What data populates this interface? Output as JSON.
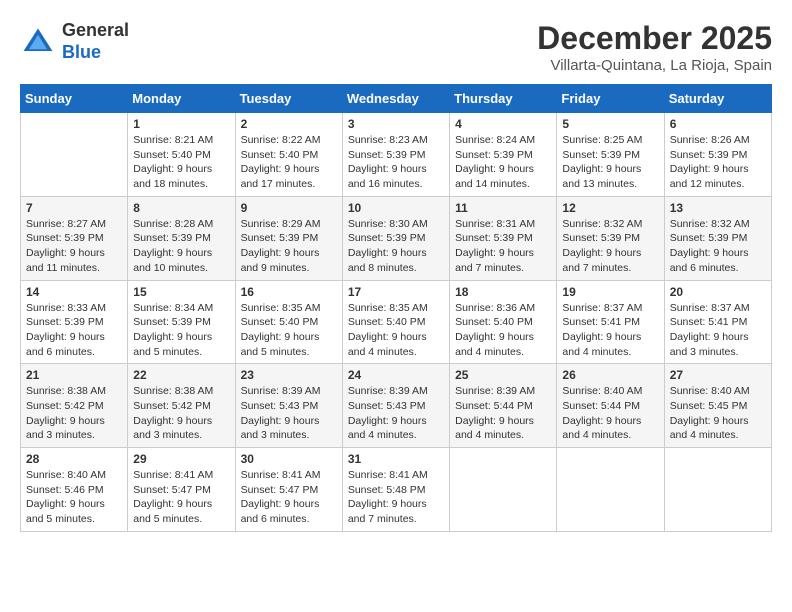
{
  "header": {
    "logo": {
      "general": "General",
      "blue": "Blue"
    },
    "title": "December 2025",
    "subtitle": "Villarta-Quintana, La Rioja, Spain"
  },
  "weekdays": [
    "Sunday",
    "Monday",
    "Tuesday",
    "Wednesday",
    "Thursday",
    "Friday",
    "Saturday"
  ],
  "weeks": [
    [
      {
        "day": "",
        "sunrise": "",
        "sunset": "",
        "daylight": ""
      },
      {
        "day": "1",
        "sunrise": "Sunrise: 8:21 AM",
        "sunset": "Sunset: 5:40 PM",
        "daylight": "Daylight: 9 hours and 18 minutes."
      },
      {
        "day": "2",
        "sunrise": "Sunrise: 8:22 AM",
        "sunset": "Sunset: 5:40 PM",
        "daylight": "Daylight: 9 hours and 17 minutes."
      },
      {
        "day": "3",
        "sunrise": "Sunrise: 8:23 AM",
        "sunset": "Sunset: 5:39 PM",
        "daylight": "Daylight: 9 hours and 16 minutes."
      },
      {
        "day": "4",
        "sunrise": "Sunrise: 8:24 AM",
        "sunset": "Sunset: 5:39 PM",
        "daylight": "Daylight: 9 hours and 14 minutes."
      },
      {
        "day": "5",
        "sunrise": "Sunrise: 8:25 AM",
        "sunset": "Sunset: 5:39 PM",
        "daylight": "Daylight: 9 hours and 13 minutes."
      },
      {
        "day": "6",
        "sunrise": "Sunrise: 8:26 AM",
        "sunset": "Sunset: 5:39 PM",
        "daylight": "Daylight: 9 hours and 12 minutes."
      }
    ],
    [
      {
        "day": "7",
        "sunrise": "Sunrise: 8:27 AM",
        "sunset": "Sunset: 5:39 PM",
        "daylight": "Daylight: 9 hours and 11 minutes."
      },
      {
        "day": "8",
        "sunrise": "Sunrise: 8:28 AM",
        "sunset": "Sunset: 5:39 PM",
        "daylight": "Daylight: 9 hours and 10 minutes."
      },
      {
        "day": "9",
        "sunrise": "Sunrise: 8:29 AM",
        "sunset": "Sunset: 5:39 PM",
        "daylight": "Daylight: 9 hours and 9 minutes."
      },
      {
        "day": "10",
        "sunrise": "Sunrise: 8:30 AM",
        "sunset": "Sunset: 5:39 PM",
        "daylight": "Daylight: 9 hours and 8 minutes."
      },
      {
        "day": "11",
        "sunrise": "Sunrise: 8:31 AM",
        "sunset": "Sunset: 5:39 PM",
        "daylight": "Daylight: 9 hours and 7 minutes."
      },
      {
        "day": "12",
        "sunrise": "Sunrise: 8:32 AM",
        "sunset": "Sunset: 5:39 PM",
        "daylight": "Daylight: 9 hours and 7 minutes."
      },
      {
        "day": "13",
        "sunrise": "Sunrise: 8:32 AM",
        "sunset": "Sunset: 5:39 PM",
        "daylight": "Daylight: 9 hours and 6 minutes."
      }
    ],
    [
      {
        "day": "14",
        "sunrise": "Sunrise: 8:33 AM",
        "sunset": "Sunset: 5:39 PM",
        "daylight": "Daylight: 9 hours and 6 minutes."
      },
      {
        "day": "15",
        "sunrise": "Sunrise: 8:34 AM",
        "sunset": "Sunset: 5:39 PM",
        "daylight": "Daylight: 9 hours and 5 minutes."
      },
      {
        "day": "16",
        "sunrise": "Sunrise: 8:35 AM",
        "sunset": "Sunset: 5:40 PM",
        "daylight": "Daylight: 9 hours and 5 minutes."
      },
      {
        "day": "17",
        "sunrise": "Sunrise: 8:35 AM",
        "sunset": "Sunset: 5:40 PM",
        "daylight": "Daylight: 9 hours and 4 minutes."
      },
      {
        "day": "18",
        "sunrise": "Sunrise: 8:36 AM",
        "sunset": "Sunset: 5:40 PM",
        "daylight": "Daylight: 9 hours and 4 minutes."
      },
      {
        "day": "19",
        "sunrise": "Sunrise: 8:37 AM",
        "sunset": "Sunset: 5:41 PM",
        "daylight": "Daylight: 9 hours and 4 minutes."
      },
      {
        "day": "20",
        "sunrise": "Sunrise: 8:37 AM",
        "sunset": "Sunset: 5:41 PM",
        "daylight": "Daylight: 9 hours and 3 minutes."
      }
    ],
    [
      {
        "day": "21",
        "sunrise": "Sunrise: 8:38 AM",
        "sunset": "Sunset: 5:42 PM",
        "daylight": "Daylight: 9 hours and 3 minutes."
      },
      {
        "day": "22",
        "sunrise": "Sunrise: 8:38 AM",
        "sunset": "Sunset: 5:42 PM",
        "daylight": "Daylight: 9 hours and 3 minutes."
      },
      {
        "day": "23",
        "sunrise": "Sunrise: 8:39 AM",
        "sunset": "Sunset: 5:43 PM",
        "daylight": "Daylight: 9 hours and 3 minutes."
      },
      {
        "day": "24",
        "sunrise": "Sunrise: 8:39 AM",
        "sunset": "Sunset: 5:43 PM",
        "daylight": "Daylight: 9 hours and 4 minutes."
      },
      {
        "day": "25",
        "sunrise": "Sunrise: 8:39 AM",
        "sunset": "Sunset: 5:44 PM",
        "daylight": "Daylight: 9 hours and 4 minutes."
      },
      {
        "day": "26",
        "sunrise": "Sunrise: 8:40 AM",
        "sunset": "Sunset: 5:44 PM",
        "daylight": "Daylight: 9 hours and 4 minutes."
      },
      {
        "day": "27",
        "sunrise": "Sunrise: 8:40 AM",
        "sunset": "Sunset: 5:45 PM",
        "daylight": "Daylight: 9 hours and 4 minutes."
      }
    ],
    [
      {
        "day": "28",
        "sunrise": "Sunrise: 8:40 AM",
        "sunset": "Sunset: 5:46 PM",
        "daylight": "Daylight: 9 hours and 5 minutes."
      },
      {
        "day": "29",
        "sunrise": "Sunrise: 8:41 AM",
        "sunset": "Sunset: 5:47 PM",
        "daylight": "Daylight: 9 hours and 5 minutes."
      },
      {
        "day": "30",
        "sunrise": "Sunrise: 8:41 AM",
        "sunset": "Sunset: 5:47 PM",
        "daylight": "Daylight: 9 hours and 6 minutes."
      },
      {
        "day": "31",
        "sunrise": "Sunrise: 8:41 AM",
        "sunset": "Sunset: 5:48 PM",
        "daylight": "Daylight: 9 hours and 7 minutes."
      },
      {
        "day": "",
        "sunrise": "",
        "sunset": "",
        "daylight": ""
      },
      {
        "day": "",
        "sunrise": "",
        "sunset": "",
        "daylight": ""
      },
      {
        "day": "",
        "sunrise": "",
        "sunset": "",
        "daylight": ""
      }
    ]
  ]
}
